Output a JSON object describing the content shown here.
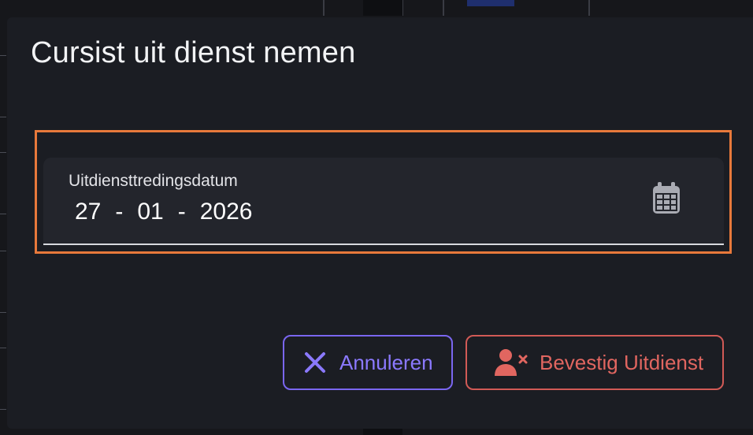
{
  "dialog": {
    "title": "Cursist uit dienst nemen"
  },
  "date_field": {
    "label": "Uitdiensttredingsdatum",
    "day": "27",
    "month": "01",
    "year": "2026",
    "separator": "-",
    "icon": "calendar-icon"
  },
  "actions": {
    "cancel_label": "Annuleren",
    "cancel_icon": "close-icon",
    "confirm_label": "Bevestig Uitdienst",
    "confirm_icon": "person-remove-icon"
  },
  "colors": {
    "highlight": "#e8793b",
    "cancel_accent": "#8b79ff",
    "confirm_accent": "#e16660",
    "dialog_bg": "#1b1d23"
  }
}
